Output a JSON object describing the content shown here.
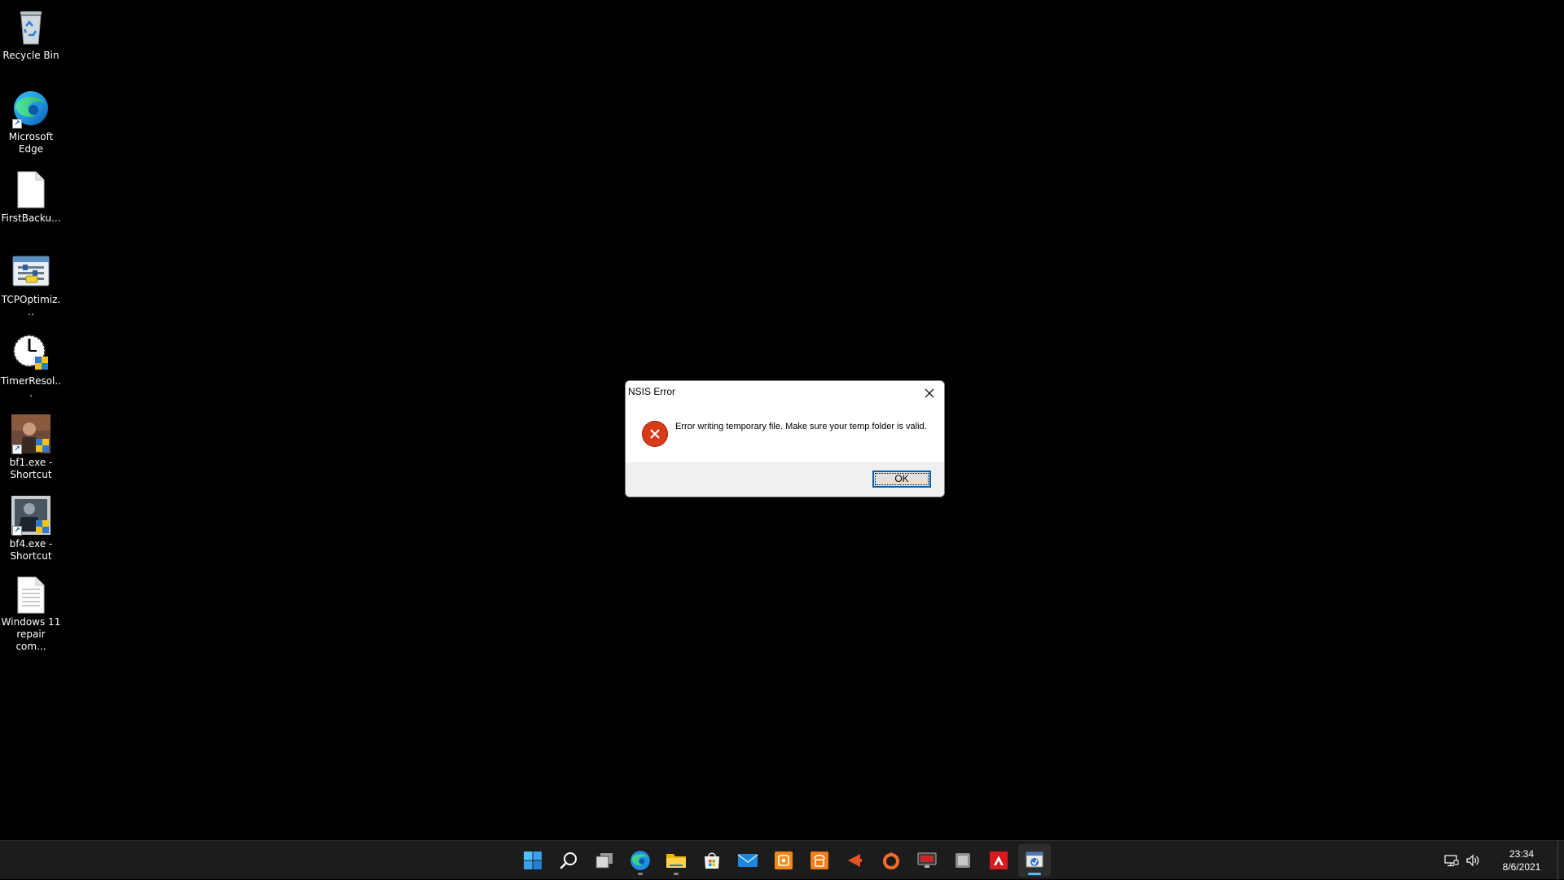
{
  "desktop": {
    "icons": [
      {
        "label": "Recycle Bin",
        "icon": "recycle-bin-icon"
      },
      {
        "label": "Microsoft Edge",
        "icon": "edge-icon"
      },
      {
        "label": "FirstBacku...",
        "icon": "blank-file-icon"
      },
      {
        "label": "TCPOptimiz...",
        "icon": "tcp-optimizer-icon"
      },
      {
        "label": "TimerResol...",
        "icon": "timer-resolution-icon"
      },
      {
        "label": "bf1.exe - Shortcut",
        "icon": "bf1-icon"
      },
      {
        "label": "bf4.exe - Shortcut",
        "icon": "bf4-icon"
      },
      {
        "label": "Windows 11 repair com...",
        "icon": "text-file-icon"
      }
    ]
  },
  "dialog": {
    "title": "NSIS Error",
    "message": "Error writing temporary file. Make sure your temp folder is valid.",
    "ok_label": "OK"
  },
  "taskbar": {
    "apps": [
      {
        "name": "start",
        "icon": "windows-start-icon",
        "active": false,
        "running": false
      },
      {
        "name": "search",
        "icon": "search-icon",
        "active": false,
        "running": false
      },
      {
        "name": "task-view",
        "icon": "task-view-icon",
        "active": false,
        "running": false
      },
      {
        "name": "edge",
        "icon": "edge-icon",
        "active": false,
        "running": true
      },
      {
        "name": "file-explorer",
        "icon": "folder-icon",
        "active": false,
        "running": true
      },
      {
        "name": "store",
        "icon": "store-icon",
        "active": false,
        "running": false
      },
      {
        "name": "mail",
        "icon": "mail-icon",
        "active": false,
        "running": false
      },
      {
        "name": "app-orange-1",
        "icon": "orange-app-icon",
        "active": false,
        "running": false
      },
      {
        "name": "app-orange-2",
        "icon": "orange-app-icon",
        "active": false,
        "running": false
      },
      {
        "name": "app-horn",
        "icon": "horn-icon",
        "active": false,
        "running": false
      },
      {
        "name": "origin",
        "icon": "origin-icon",
        "active": false,
        "running": false
      },
      {
        "name": "app-monitor",
        "icon": "monitor-icon",
        "active": false,
        "running": false
      },
      {
        "name": "app-square",
        "icon": "square-app-icon",
        "active": false,
        "running": false
      },
      {
        "name": "amd",
        "icon": "amd-icon",
        "active": false,
        "running": false
      },
      {
        "name": "installer",
        "icon": "installer-icon",
        "active": true,
        "running": true
      }
    ],
    "clock": {
      "time": "23:34",
      "date": "8/6/2021"
    }
  },
  "colors": {
    "desktop_bg": "#000000",
    "taskbar_bg": "#1c1c1c",
    "error_red": "#d83b1a",
    "accent": "#4cc2ff"
  }
}
